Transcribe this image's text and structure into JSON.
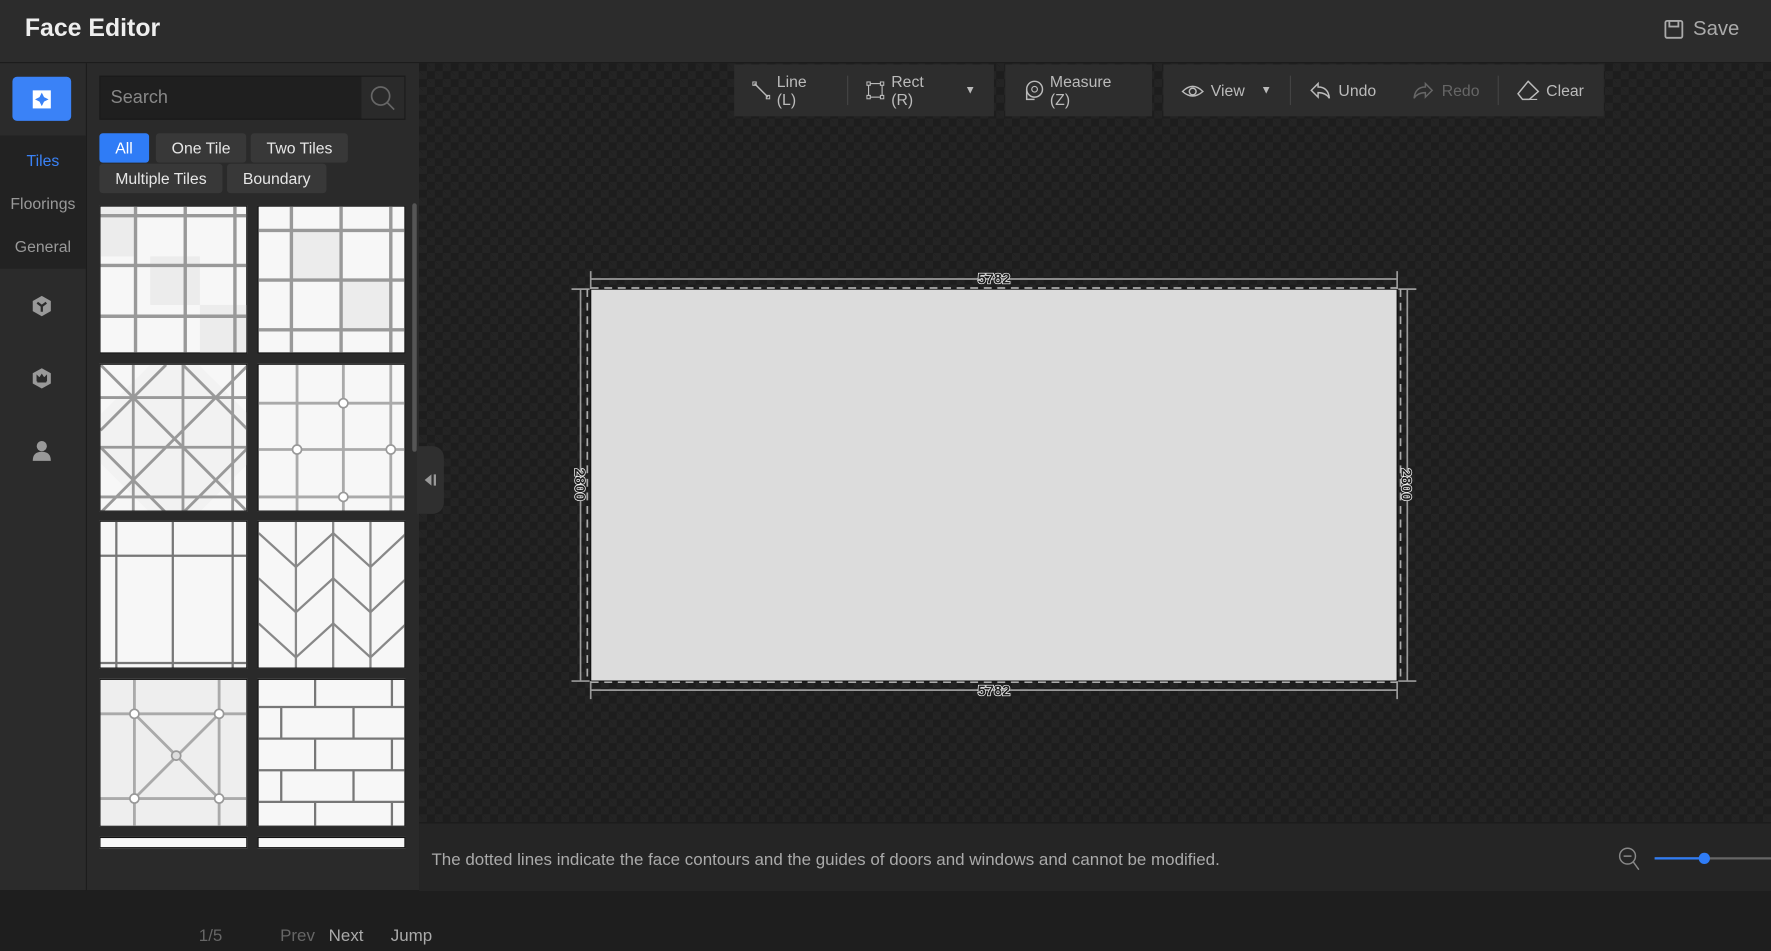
{
  "header": {
    "title": "Face Editor",
    "save_label": "Save"
  },
  "rail": {
    "submenu": [
      {
        "label": "Tiles",
        "active": true
      },
      {
        "label": "Floorings"
      },
      {
        "label": "General"
      }
    ],
    "icons": [
      "tiles-icon",
      "model-icon",
      "brand-icon",
      "user-icon"
    ]
  },
  "panel": {
    "search_placeholder": "Search",
    "chips": [
      {
        "label": "All",
        "active": true
      },
      {
        "label": "One Tile"
      },
      {
        "label": "Two Tiles"
      },
      {
        "label": "Multiple Tiles"
      },
      {
        "label": "Boundary"
      }
    ],
    "tiles": [
      "grid-offset",
      "grid-square",
      "diagonal-cross",
      "grid-dots",
      "square-large",
      "herringbone",
      "diamond-dots",
      "brick"
    ],
    "pager": {
      "page": "1/5",
      "prev": "Prev",
      "next": "Next",
      "jump": "Jump"
    }
  },
  "toolbar": {
    "line": "Line (L)",
    "rect": "Rect (R)",
    "measure": "Measure (Z)",
    "view": "View",
    "undo": "Undo",
    "redo": "Redo",
    "clear": "Clear"
  },
  "face": {
    "width": "5782",
    "height": "2800"
  },
  "footer": {
    "hint": "The dotted lines indicate the face contours and the guides of doors and windows and cannot be modified."
  },
  "zoom": {
    "level": 0.3
  },
  "colors": {
    "accent": "#2f7cf6"
  }
}
